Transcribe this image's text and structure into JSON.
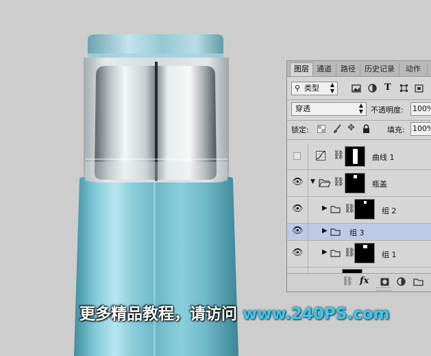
{
  "panel": {
    "tabs": [
      "图层",
      "通道",
      "路径",
      "历史记录",
      "动作"
    ],
    "active_tab": "图层",
    "filter": {
      "value": "类型"
    },
    "blend": {
      "mode": "穿透",
      "opacity_label": "不透明度:",
      "opacity_value": "100%"
    },
    "lock": {
      "label": "锁定:",
      "fill_label": "填充:",
      "fill_value": "100%"
    },
    "layers": [
      {
        "name": "曲线 1",
        "visible": false,
        "kind": "adjustment"
      },
      {
        "name": "瓶盖",
        "visible": true,
        "kind": "group-expanded"
      },
      {
        "name": "组 2",
        "visible": true,
        "kind": "group"
      },
      {
        "name": "组 3",
        "visible": true,
        "kind": "group",
        "selected": true
      },
      {
        "name": "组 1",
        "visible": true,
        "kind": "group"
      }
    ],
    "footer_icons": [
      "link-icon",
      "fx-icon",
      "mask-icon",
      "adjustment-icon",
      "folder-icon"
    ]
  },
  "watermark": {
    "cn": "更多精品教程，请访问",
    "url": "www.240PS.com"
  },
  "colors": {
    "panel_bg": "#d6d6d6",
    "selected": "#bccae6",
    "bottle": "#7cc0cf",
    "url": "#3dc8ea"
  }
}
